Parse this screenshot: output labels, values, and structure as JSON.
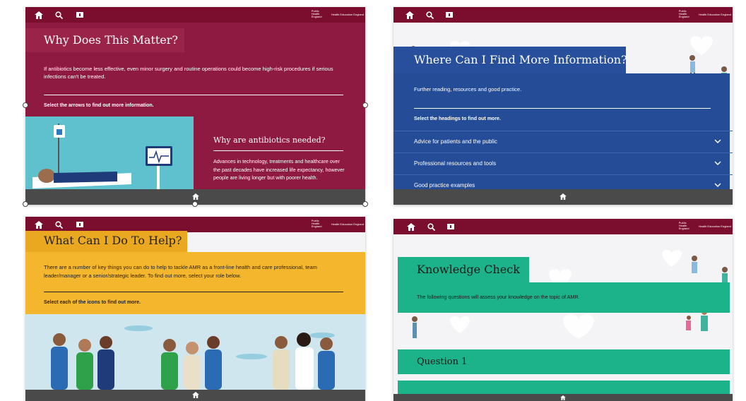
{
  "panels": {
    "p1": {
      "title": "Why Does This Matter?",
      "intro": "If antibiotics become less effective, even minor surgery and routine operations could become high-risk procedures if serious infections can't be treated.",
      "instruction": "Select the arrows to find out more information.",
      "card_title": "Why are antibiotics needed?",
      "card_text": "Advances in technology, treatments and healthcare over the past decades have increased life expectancy, however people are living longer but with poorer health."
    },
    "p2": {
      "title": "Where Can I Find More Information?",
      "intro": "Further reading, resources and good practice.",
      "instruction": "Select the headings to find out more.",
      "accordion": [
        "Advice for patients and the public",
        "Professional resources and tools",
        "Good practice examples"
      ]
    },
    "p3": {
      "title": "What Can I Do To Help?",
      "intro": "There are a number of key things you can do to help to tackle AMR as a front-line health and care professional, team leader/manager or a senior/strategic leader. To find out more, select your role below.",
      "instruction": "Select each of the icons to find out more."
    },
    "p4": {
      "title": "Knowledge Check",
      "intro": "The following questions will assess your knowledge on the topic of AMR.",
      "question": "Question 1"
    }
  },
  "topbar": {
    "logo_text": "Public Health England",
    "logo_right": "Health Education England"
  },
  "colors": {
    "topbar": "#7b0d2e",
    "p1_accent": "#8e1a41",
    "p2_accent": "#244c97",
    "p3_accent": "#f4b62c",
    "p4_accent": "#1db38a",
    "bottombar": "#4a4a4a"
  },
  "icons": [
    "home-icon",
    "search-icon",
    "bookmark-icon",
    "chevron-down-icon"
  ]
}
